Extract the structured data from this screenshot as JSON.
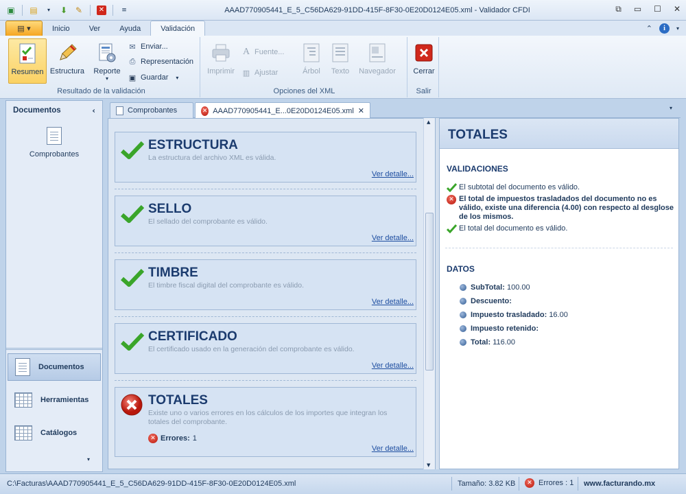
{
  "window": {
    "title": "AAAD770905441_E_5_C56DA629-91DD-415F-8F30-0E20D0124E05.xml - Validador CFDI"
  },
  "ribbon": {
    "tabs": [
      "Inicio",
      "Ver",
      "Ayuda",
      "Validación"
    ],
    "active_tab": "Validación",
    "groups": {
      "resultado": {
        "label": "Resultado de la validación",
        "resumen": "Resumen",
        "estructura": "Estructura",
        "reporte": "Reporte",
        "enviar": "Enviar...",
        "representacion": "Representación",
        "guardar": "Guardar"
      },
      "opciones": {
        "label": "Opciones del XML",
        "imprimir": "Imprimir",
        "fuente": "Fuente...",
        "ajustar": "Ajustar",
        "arbol": "Árbol",
        "texto": "Texto",
        "navegador": "Navegador"
      },
      "salir": {
        "label": "Salir",
        "cerrar": "Cerrar"
      }
    }
  },
  "sidebar": {
    "title": "Documentos",
    "item": "Comprobantes",
    "nav": [
      {
        "label": "Documentos"
      },
      {
        "label": "Herramientas"
      },
      {
        "label": "Catálogos"
      }
    ]
  },
  "doc_tabs": [
    {
      "label": "Comprobantes"
    },
    {
      "label": "AAAD770905441_E...0E20D0124E05.xml"
    }
  ],
  "cards": [
    {
      "title": "ESTRUCTURA",
      "desc": "La estructura del archivo XML es válida.",
      "link": "Ver detalle...",
      "status": "ok"
    },
    {
      "title": "SELLO",
      "desc": "El sellado del comprobante es válido.",
      "link": "Ver detalle...",
      "status": "ok"
    },
    {
      "title": "TIMBRE",
      "desc": "El timbre fiscal digital del comprobante es válido.",
      "link": "Ver detalle...",
      "status": "ok"
    },
    {
      "title": "CERTIFICADO",
      "desc": "El certificado usado en la generación del comprobante es válido.",
      "link": "Ver detalle...",
      "status": "ok"
    },
    {
      "title": "TOTALES",
      "desc": "Existe uno o varios errores en los cálculos de los importes que integran los totales del comprobante.",
      "errors_label": "Errores:",
      "errors_count": "1",
      "link": "Ver detalle...",
      "status": "error"
    }
  ],
  "right_panel": {
    "title": "TOTALES",
    "validaciones_title": "VALIDACIONES",
    "validaciones": [
      {
        "text": "El subtotal del documento es válido.",
        "status": "ok"
      },
      {
        "text": "El total de impuestos trasladados del documento no es válido, existe una diferencia (4.00) con respecto al desglose de los mismos.",
        "status": "error"
      },
      {
        "text": "El total del documento es válido.",
        "status": "ok"
      }
    ],
    "datos_title": "DATOS",
    "datos": [
      {
        "label": "SubTotal:",
        "value": "100.00"
      },
      {
        "label": "Descuento:",
        "value": ""
      },
      {
        "label": "Impuesto trasladado:",
        "value": "16.00"
      },
      {
        "label": "Impuesto retenido:",
        "value": ""
      },
      {
        "label": "Total:",
        "value": "116.00"
      }
    ]
  },
  "status": {
    "path": "C:\\Facturas\\AAAD770905441_E_5_C56DA629-91DD-415F-8F30-0E20D0124E05.xml",
    "size": "Tamaño: 3.82 KB",
    "errors": "Errores : 1",
    "site": "www.facturando.mx"
  },
  "colors": {
    "ok_green": "#3aa52a",
    "error_red": "#c8190d",
    "link_blue": "#1e4ea0",
    "accent_orange": "#f5a623"
  }
}
